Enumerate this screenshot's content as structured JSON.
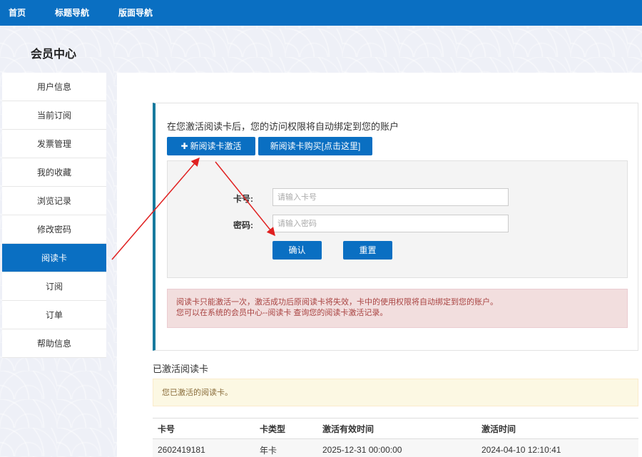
{
  "topnav": {
    "home": "首页",
    "title_nav": "标题导航",
    "layout_nav": "版面导航"
  },
  "page_title": "会员中心",
  "sidebar": {
    "items": [
      {
        "label": "用户信息"
      },
      {
        "label": "当前订阅"
      },
      {
        "label": "发票管理"
      },
      {
        "label": "我的收藏"
      },
      {
        "label": "浏览记录"
      },
      {
        "label": "修改密码"
      },
      {
        "label": "阅读卡",
        "active": true
      },
      {
        "label": "订阅"
      },
      {
        "label": "订单"
      },
      {
        "label": "帮助信息"
      }
    ]
  },
  "activation": {
    "intro": "在您激活阅读卡后，您的访问权限将自动绑定到您的账户",
    "activate_label": "新阅读卡激活",
    "buy_label": "新阅读卡购买[点击这里]",
    "card_label": "卡号:",
    "card_placeholder": "请输入卡号",
    "password_label": "密码:",
    "password_placeholder": "请输入密码",
    "confirm_label": "确认",
    "reset_label": "重置",
    "notice_line1": "阅读卡只能激活一次，激活成功后原阅读卡将失效，卡中的使用权限将自动绑定到您的账户。",
    "notice_line2": "您可以在系统的会员中心--阅读卡 查询您的阅读卡激活记录。"
  },
  "activated": {
    "title": "已激活阅读卡",
    "notice": "您已激活的阅读卡。",
    "columns": [
      "卡号",
      "卡类型",
      "激活有效时间",
      "激活时间"
    ],
    "rows": [
      [
        "2602419181",
        "年卡",
        "2025-12-31 00:00:00",
        "2024-04-10 12:10:41"
      ]
    ]
  },
  "colors": {
    "primary": "#0a6fc2",
    "annotation": "#e02020"
  }
}
